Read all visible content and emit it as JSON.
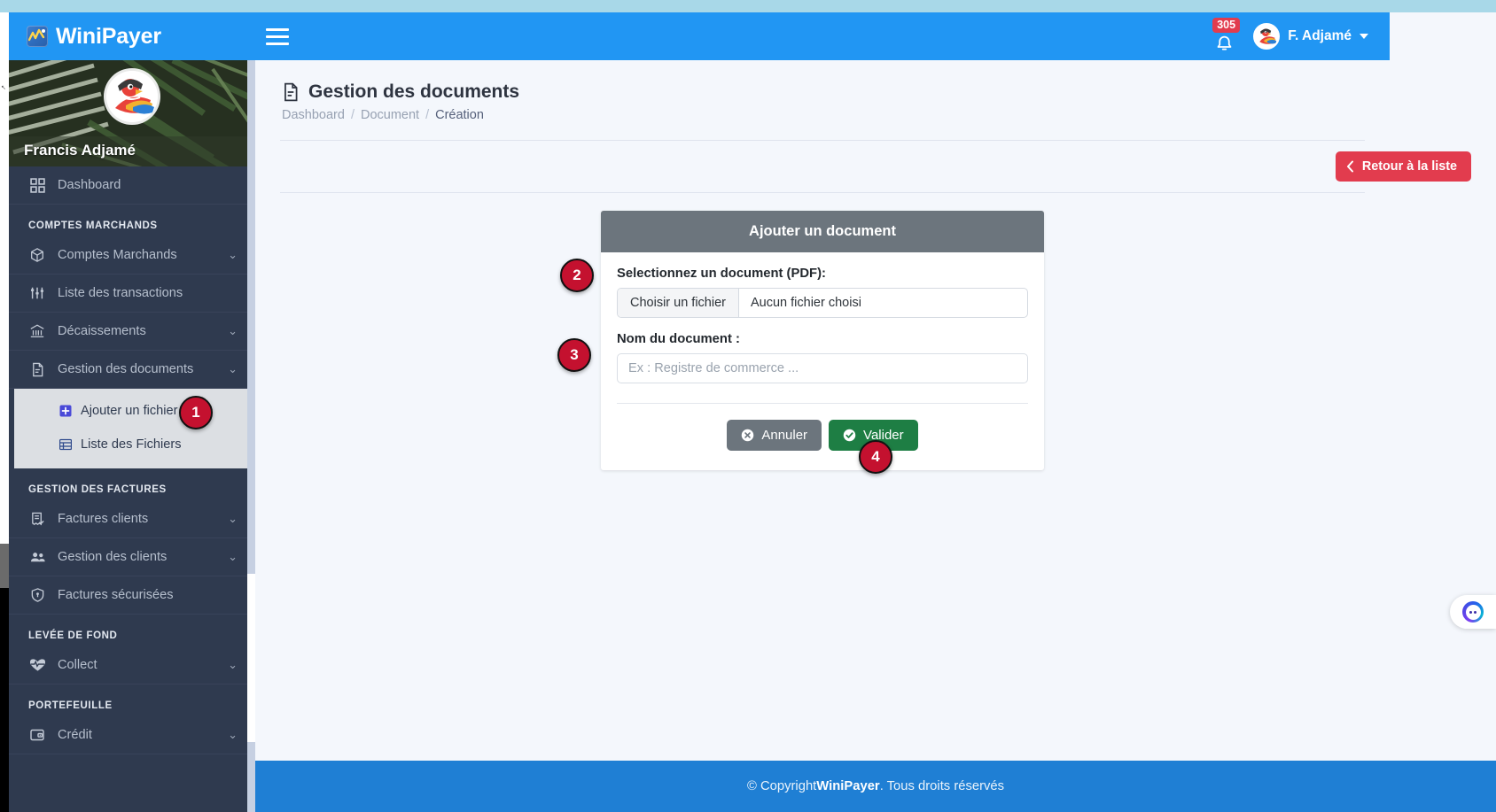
{
  "header": {
    "brand": "WiniPayer",
    "brand_logo_icon": "winipayer-logo-icon",
    "menu_toggle_icon": "hamburger-menu-icon",
    "notification_icon": "bell-icon",
    "notification_count": "305",
    "user_name": "F. Adjamé",
    "avatar_icon": "user-avatar-parrot",
    "caret_icon": "chevron-down-icon",
    "accent_color": "#2196f3"
  },
  "sidebar": {
    "profile_name": "Francis Adjamé",
    "profile_avatar_icon": "profile-avatar-parrot",
    "groups": [
      {
        "label": null,
        "items": [
          {
            "label": "Dashboard",
            "icon": "grid-dashboard-icon",
            "expandable": false
          }
        ]
      },
      {
        "label": "COMPTES MARCHANDS",
        "items": [
          {
            "label": "Comptes Marchands",
            "icon": "box-icon",
            "expandable": true
          },
          {
            "label": "Liste des transactions",
            "icon": "sliders-icon",
            "expandable": false
          },
          {
            "label": "Décaissements",
            "icon": "bank-icon",
            "expandable": true
          },
          {
            "label": "Gestion des documents",
            "icon": "document-icon",
            "expandable": true
          }
        ]
      }
    ],
    "submenu": {
      "parent": "Gestion des documents",
      "items": [
        {
          "label": "Ajouter un fichier",
          "icon": "plus-square-icon",
          "active": true
        },
        {
          "label": "Liste des Fichiers",
          "icon": "table-list-icon",
          "active": false
        }
      ]
    },
    "groups_after": [
      {
        "label": "GESTION DES FACTURES",
        "items": [
          {
            "label": "Factures clients",
            "icon": "invoice-check-icon",
            "expandable": true
          },
          {
            "label": "Gestion des clients",
            "icon": "users-icon",
            "expandable": true
          },
          {
            "label": "Factures sécurisées",
            "icon": "shield-lock-icon",
            "expandable": false
          }
        ]
      },
      {
        "label": "LEVÉE DE FOND",
        "items": [
          {
            "label": "Collect",
            "icon": "heart-pulse-icon",
            "expandable": true
          }
        ]
      },
      {
        "label": "PORTEFEUILLE",
        "items": [
          {
            "label": "Crédit",
            "icon": "wallet-icon",
            "expandable": true
          }
        ]
      }
    ]
  },
  "page": {
    "title": "Gestion des documents",
    "title_icon": "document-text-icon",
    "breadcrumb": [
      "Dashboard",
      "Document",
      "Création"
    ],
    "back_button": {
      "label": "Retour à la liste",
      "icon": "chevron-left-icon",
      "color": "#e23c4e"
    }
  },
  "card": {
    "title": "Ajouter un document",
    "header_color": "#6c757d",
    "file_label": "Selectionnez un document (PDF):",
    "file_button": "Choisir un fichier",
    "file_status": "Aucun fichier choisi",
    "name_label": "Nom du document :",
    "name_placeholder": "Ex : Registre de commerce ...",
    "name_value": "",
    "cancel_button": {
      "label": "Annuler",
      "icon": "circle-x-icon",
      "color": "#6c757d"
    },
    "validate_button": {
      "label": "Valider",
      "icon": "circle-check-icon",
      "color": "#1e7e44"
    }
  },
  "markers": [
    {
      "id": "1",
      "label": "1"
    },
    {
      "id": "2",
      "label": "2"
    },
    {
      "id": "3",
      "label": "3"
    },
    {
      "id": "4",
      "label": "4"
    }
  ],
  "footer": {
    "prefix": "© Copyright ",
    "brand": "WiniPayer",
    "suffix": ". Tous droits réservés"
  },
  "chat": {
    "icon": "chat-bubble-icon"
  }
}
